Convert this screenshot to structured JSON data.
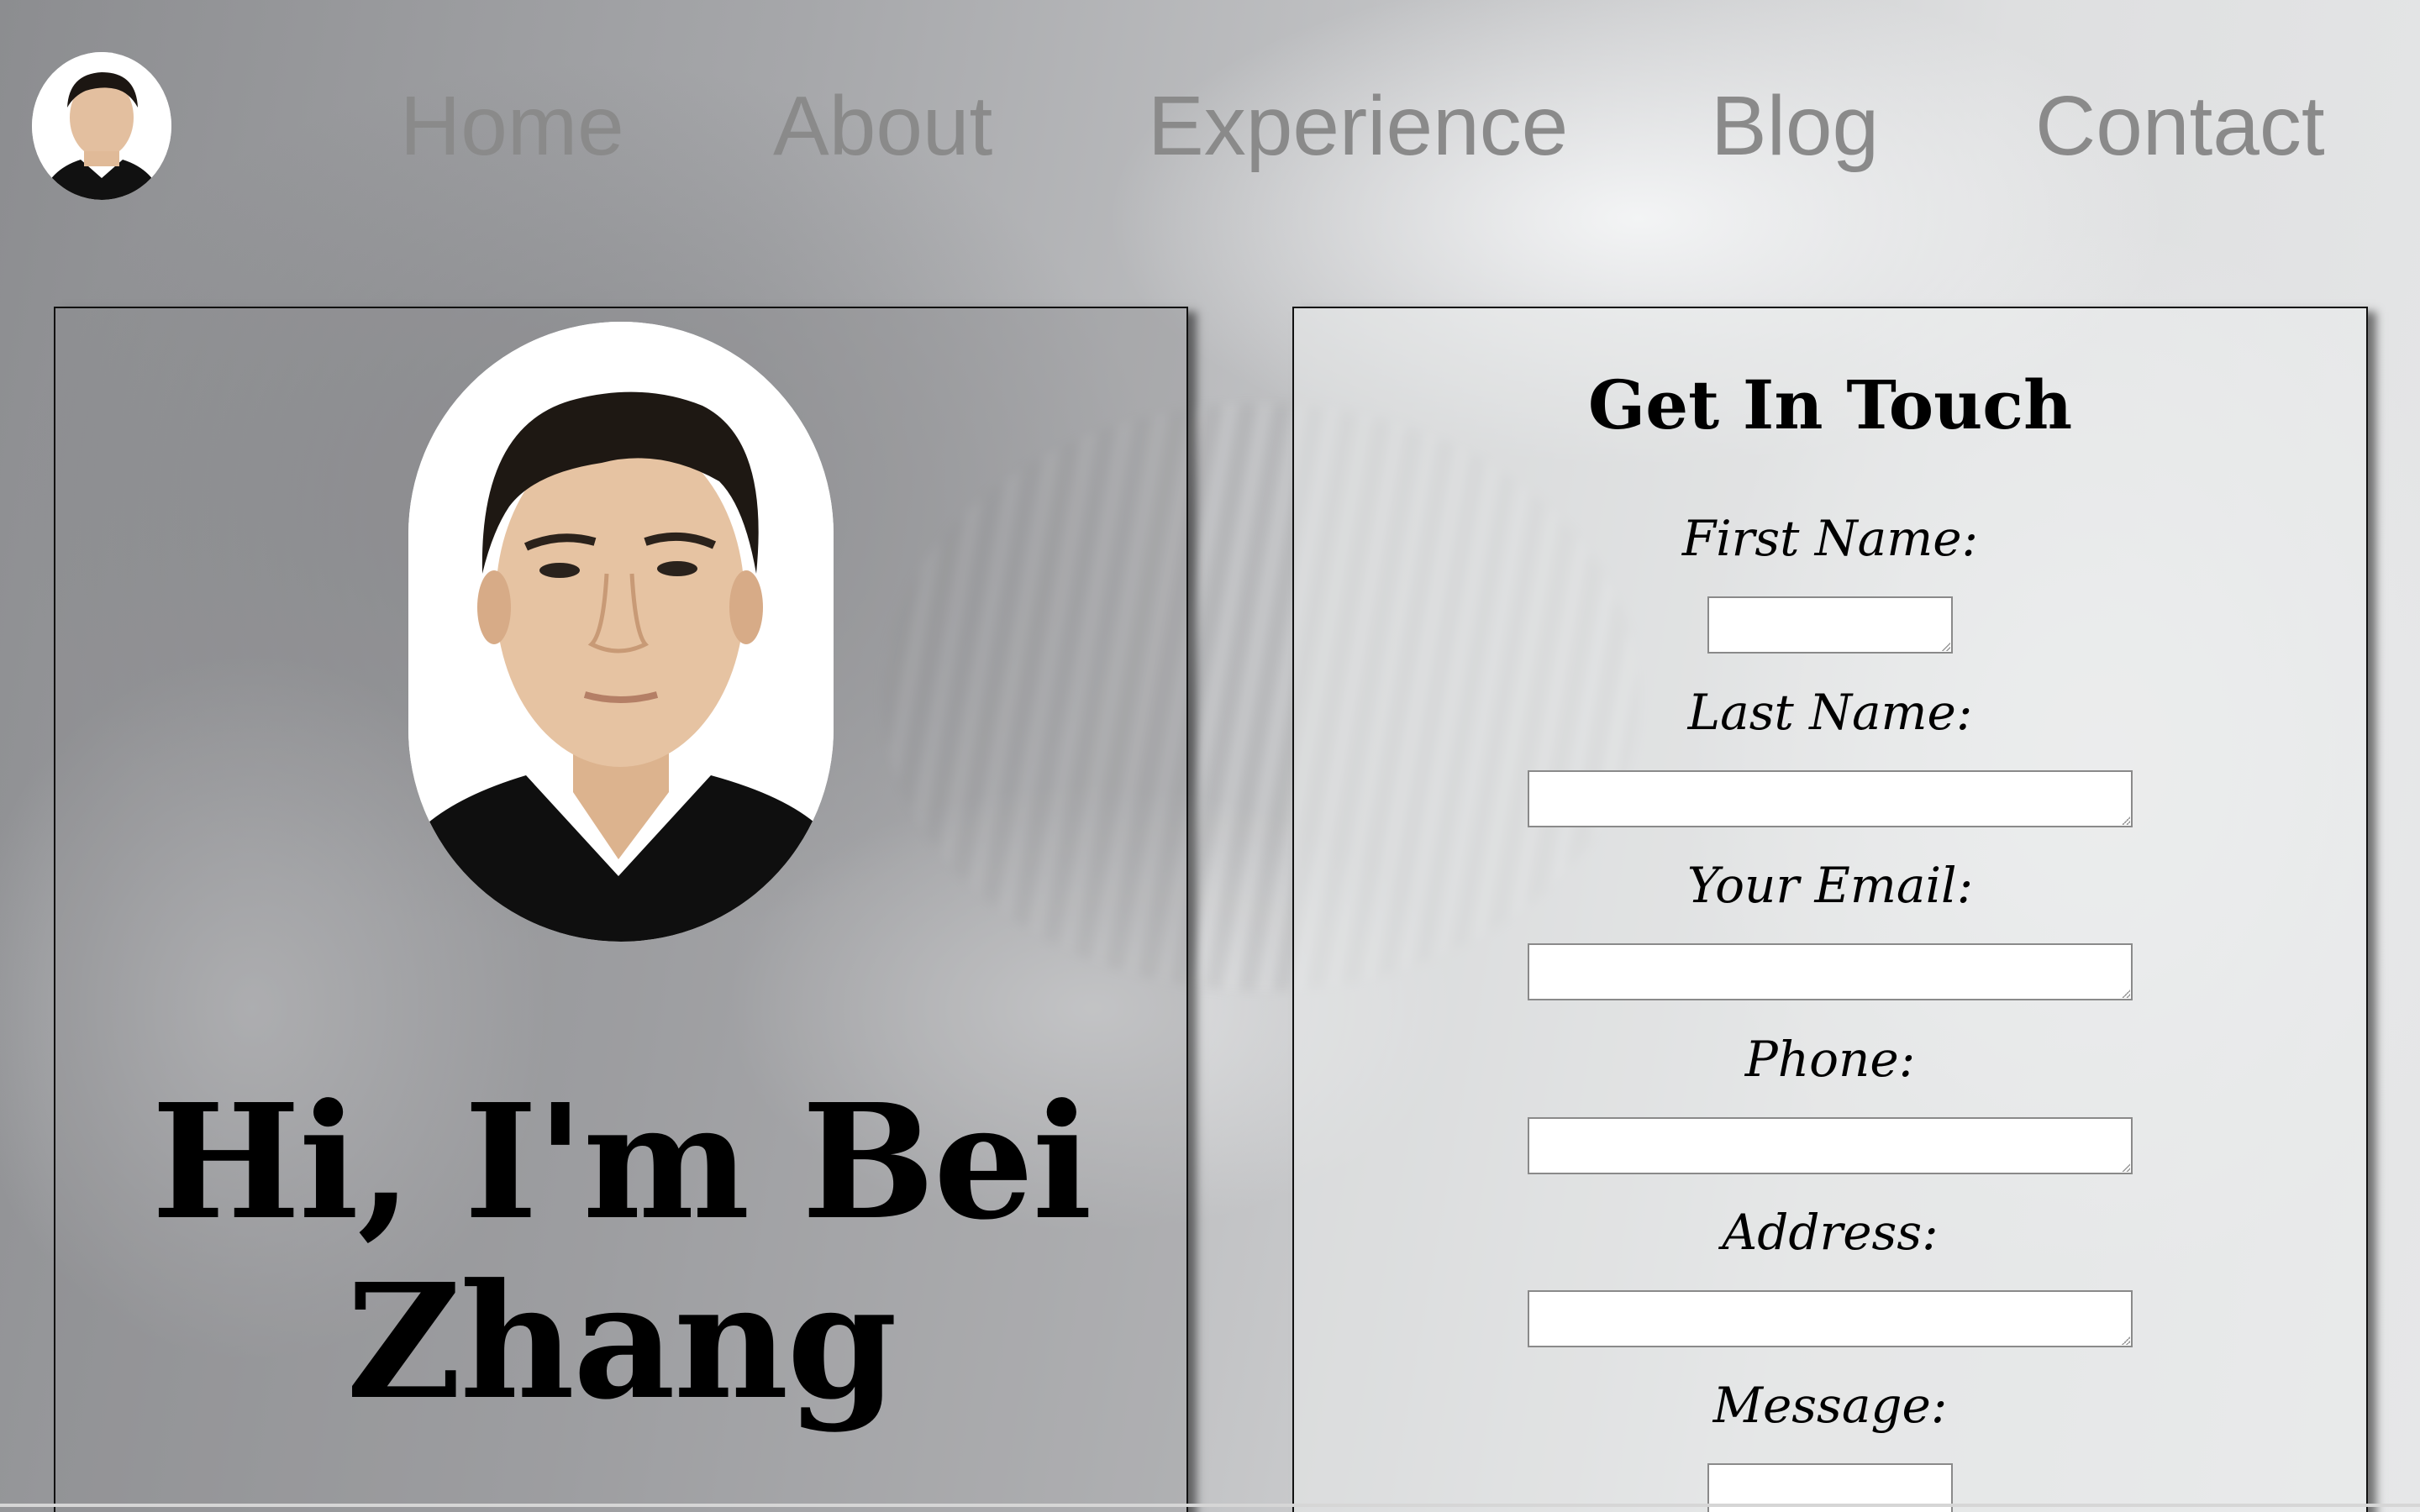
{
  "nav": {
    "links": [
      "Home",
      "About",
      "Experience",
      "Blog",
      "Contact"
    ]
  },
  "hero": {
    "line1": "Hi, I'm Bei",
    "line2": "Zhang"
  },
  "form": {
    "title": "Get In Touch",
    "fields": [
      {
        "label": "First Name:",
        "value": ""
      },
      {
        "label": "Last Name:",
        "value": ""
      },
      {
        "label": "Your Email:",
        "value": ""
      },
      {
        "label": "Phone:",
        "value": ""
      },
      {
        "label": "Address:",
        "value": ""
      },
      {
        "label": "Message:",
        "value": ""
      }
    ]
  }
}
